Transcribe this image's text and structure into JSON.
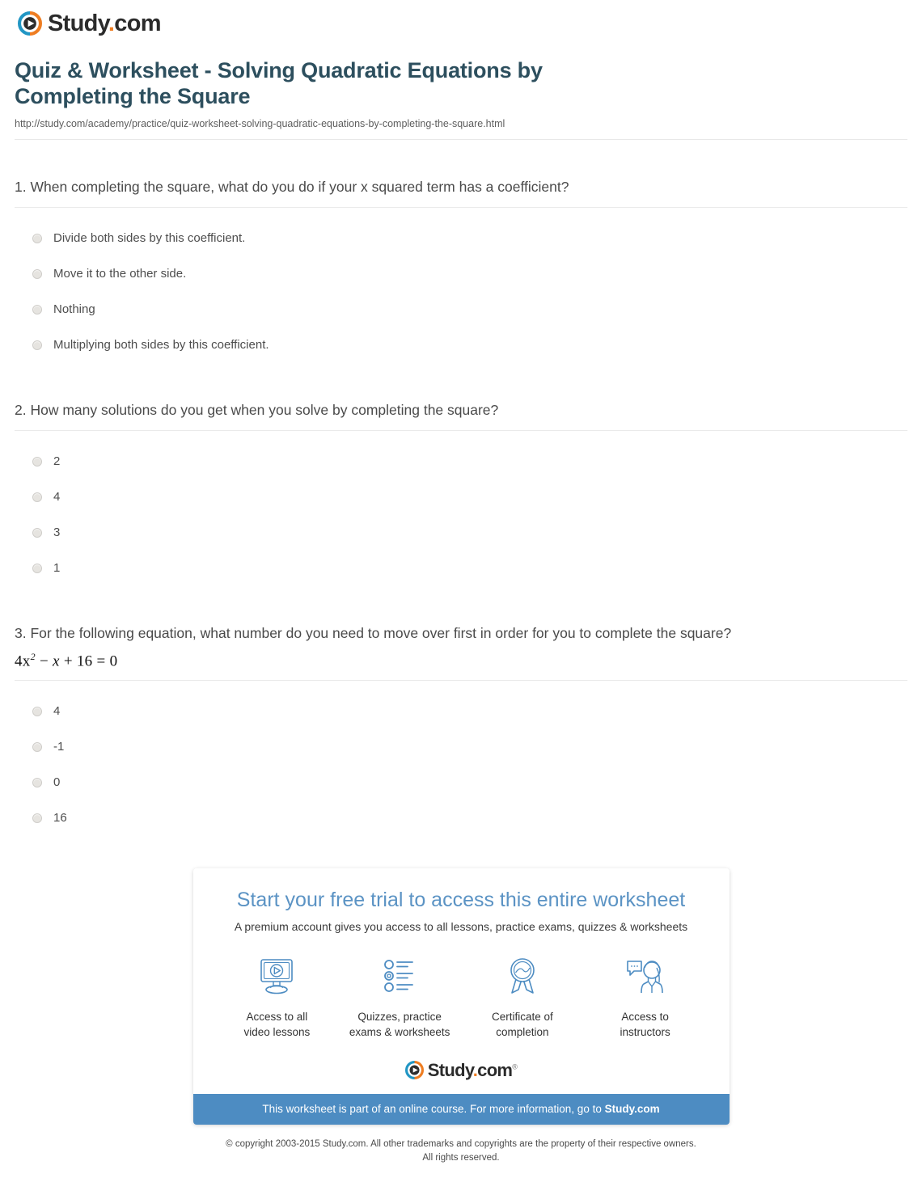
{
  "brand": {
    "name_main": "Study",
    "name_dot": ".",
    "name_tld": "com",
    "trademark": "®",
    "logo_icon": "play-circle-icon",
    "color_blue": "#2196c4",
    "color_orange": "#ee7d22"
  },
  "document": {
    "title": "Quiz & Worksheet - Solving Quadratic Equations by Completing the Square",
    "url": "http://study.com/academy/practice/quiz-worksheet-solving-quadratic-equations-by-completing-the-square.html"
  },
  "questions": [
    {
      "number": "1.",
      "text": "When completing the square, what do you do if your x squared term has a coefficient?",
      "equation": null,
      "options": [
        "Divide both sides by this coefficient.",
        "Move it to the other side.",
        "Nothing",
        "Multiplying both sides by this coefficient."
      ]
    },
    {
      "number": "2.",
      "text": "How many solutions do you get when you solve by completing the square?",
      "equation": null,
      "options": [
        "2",
        "4",
        "3",
        "1"
      ]
    },
    {
      "number": "3.",
      "text": "For the following equation, what number do you need to move over first in order for you to complete the square?",
      "equation": {
        "lead": "4x",
        "exponent": "2",
        "rest_a": " − ",
        "var_a": "x",
        "rest_b": " + 16 = 0"
      },
      "options": [
        "4",
        "-1",
        "0",
        "16"
      ]
    }
  ],
  "promo": {
    "title": "Start your free trial to access this entire worksheet",
    "subtitle": "A premium account gives you access to all lessons, practice exams, quizzes & worksheets",
    "features": [
      {
        "icon": "monitor-play-icon",
        "label": "Access to all\nvideo lessons"
      },
      {
        "icon": "checklist-icon",
        "label": "Quizzes, practice\nexams & worksheets"
      },
      {
        "icon": "award-ribbon-icon",
        "label": "Certificate of\ncompletion"
      },
      {
        "icon": "instructor-chat-icon",
        "label": "Access to\ninstructors"
      }
    ],
    "bar_text_prefix": "This worksheet is part of an online course. For more information, go to ",
    "bar_text_link": "Study.com",
    "bar_color": "#4d8cc2"
  },
  "footer": {
    "copyright_line1": "© copyright 2003-2015 Study.com. All other trademarks and copyrights are the property of their respective owners.",
    "copyright_line2": "All rights reserved."
  }
}
